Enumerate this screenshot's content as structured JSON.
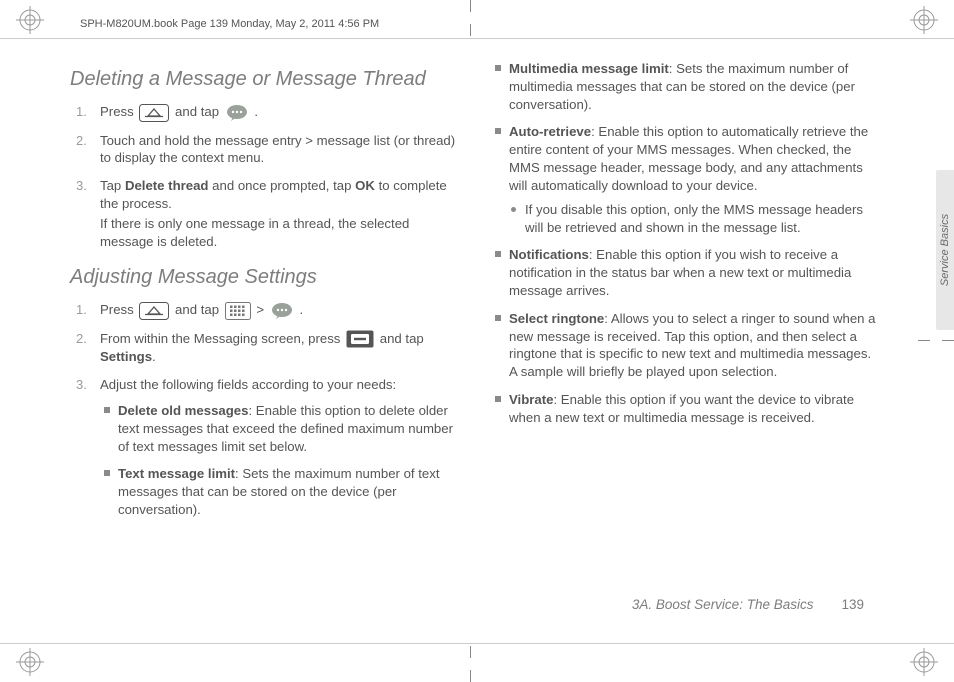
{
  "meta": {
    "book_header": "SPH-M820UM.book  Page 139  Monday, May 2, 2011  4:56 PM",
    "side_tab": "Service Basics",
    "footer_section": "3A. Boost Service: The Basics",
    "page_number": "139"
  },
  "left": {
    "h_deleting": "Deleting a Message or Message Thread",
    "del_steps": {
      "s1a": "Press ",
      "s1b": " and tap ",
      "s1c": " .",
      "s2": "Touch and hold the message entry > message list (or thread) to display the context menu.",
      "s3a": "Tap ",
      "s3b": "Delete thread",
      "s3c": " and once prompted, tap ",
      "s3d": "OK",
      "s3e": " to complete the process.",
      "s3f": "If there is only one message in a thread, the selected message is deleted."
    },
    "h_adjust": "Adjusting Message Settings",
    "adj_steps": {
      "s1a": "Press ",
      "s1b": " and tap ",
      "s1c": "  >  ",
      "s1d": " .",
      "s2a": "From within the Messaging screen, press ",
      "s2b": " and tap ",
      "s2c": "Settings",
      "s2d": ".",
      "s3": "Adjust the following fields according to your needs:"
    },
    "adj_fields": {
      "f1_label": "Delete old messages",
      "f1_text": ": Enable this option to delete older text messages that exceed the defined maximum number of text messages limit set below.",
      "f2_label": "Text message limit",
      "f2_text": ": Sets the maximum number of text messages that can be stored on the device (per conversation)."
    }
  },
  "right": {
    "fields": {
      "f3_label": "Multimedia message limit",
      "f3_text": ": Sets the maximum number of multimedia messages that can be stored on the device (per conversation).",
      "f4_label": "Auto-retrieve",
      "f4_text": ": Enable this option to automatically retrieve the entire content of your MMS messages. When checked, the MMS message header, message body, and any attachments will automatically download to your device.",
      "f4_sub": "If you disable this option, only the MMS message headers will be retrieved and shown in the message list.",
      "f5_label": "Notifications",
      "f5_text": ": Enable this option if you wish to receive a notification in the status bar when a new text or multimedia message arrives.",
      "f6_label": "Select ringtone",
      "f6_text": ": Allows you to select a ringer to sound when a new message is received. Tap this option, and then select a ringtone that is specific to new text and multimedia messages. A sample will briefly be played upon selection.",
      "f7_label": "Vibrate",
      "f7_text": ": Enable this option if you want the device to vibrate when a new text or multimedia message is received."
    }
  }
}
